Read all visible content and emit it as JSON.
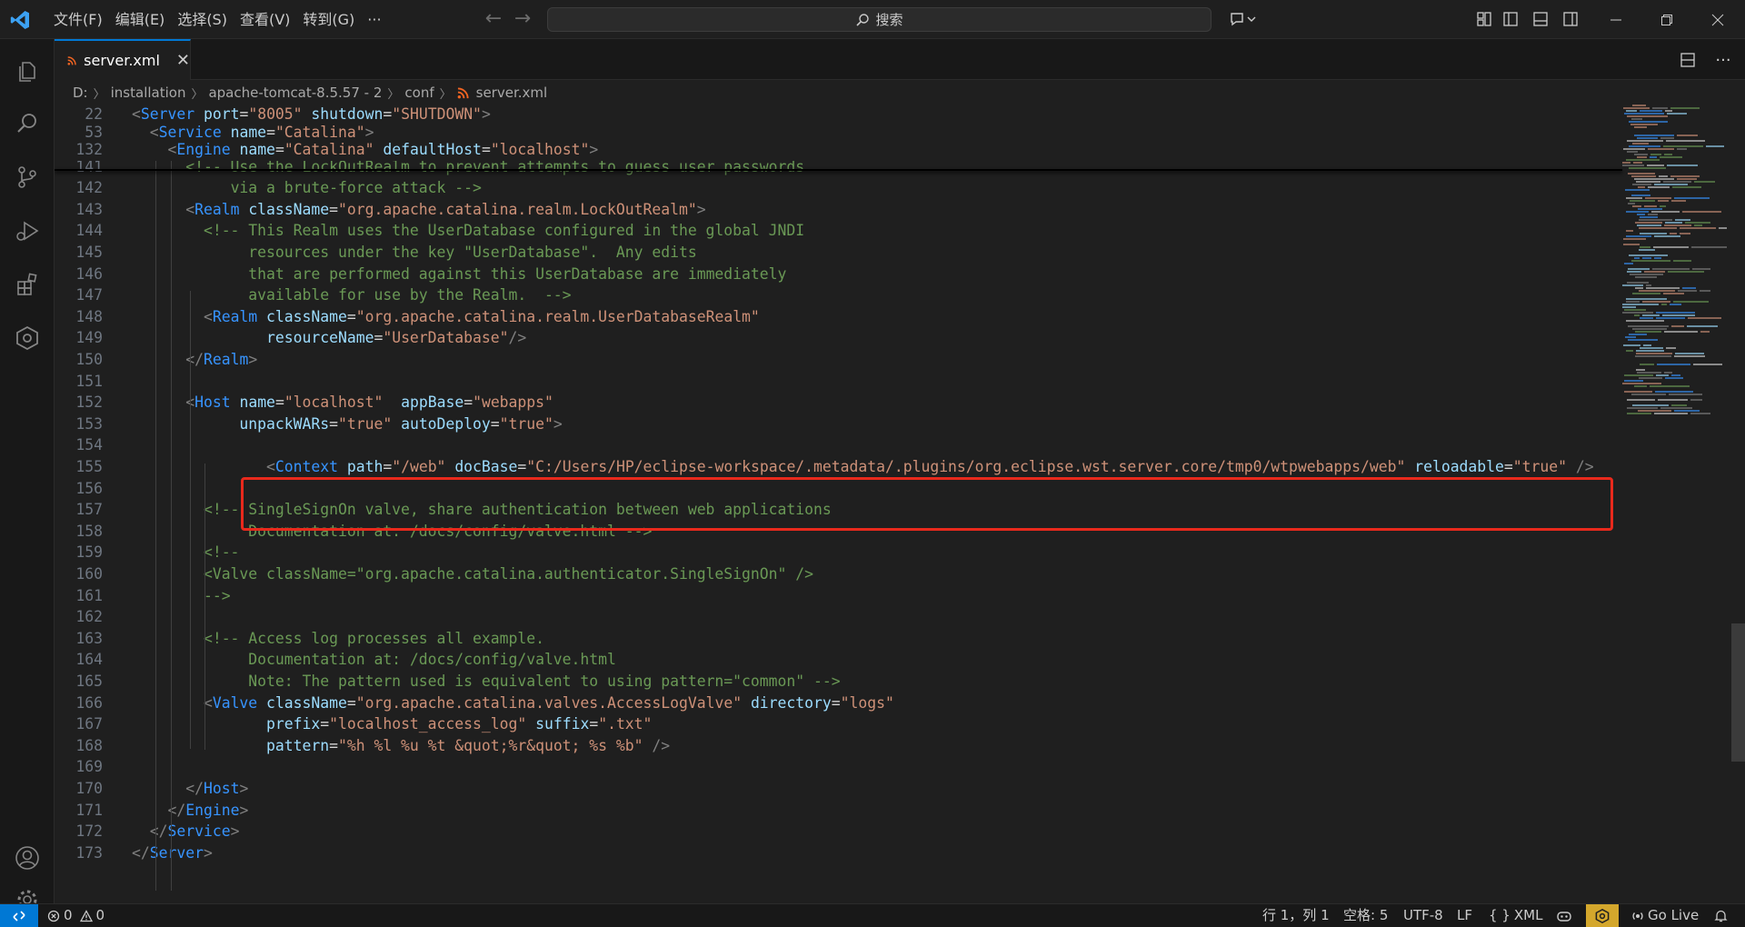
{
  "menu": [
    "文件(F)",
    "编辑(E)",
    "选择(S)",
    "查看(V)",
    "转到(G)",
    "···"
  ],
  "search": {
    "label": "搜索"
  },
  "colors": {
    "accent": "#0078d4",
    "highlight": "#e8291c",
    "copilot_status": "#d4a72c"
  },
  "tab": {
    "title": "server.xml",
    "icon": "rss-xml-file-icon"
  },
  "breadcrumb": [
    "D:",
    "installation",
    "apache-tomcat-8.5.57 - 2",
    "conf",
    "server.xml"
  ],
  "sticky": [
    {
      "ln": "22",
      "segs": [
        [
          "t-punc",
          "<"
        ],
        [
          "t-tag",
          "Server"
        ],
        [
          "t-text",
          " "
        ],
        [
          "t-attr",
          "port"
        ],
        [
          "t-text",
          "="
        ],
        [
          "t-str",
          "\"8005\""
        ],
        [
          "t-text",
          " "
        ],
        [
          "t-attr",
          "shutdown"
        ],
        [
          "t-text",
          "="
        ],
        [
          "t-str",
          "\"SHUTDOWN\""
        ],
        [
          "t-punc",
          ">"
        ]
      ],
      "indent": ""
    },
    {
      "ln": "53",
      "segs": [
        [
          "t-punc",
          "<"
        ],
        [
          "t-tag",
          "Service"
        ],
        [
          "t-text",
          " "
        ],
        [
          "t-attr",
          "name"
        ],
        [
          "t-text",
          "="
        ],
        [
          "t-str",
          "\"Catalina\""
        ],
        [
          "t-punc",
          ">"
        ]
      ],
      "indent": "  "
    },
    {
      "ln": "132",
      "segs": [
        [
          "t-punc",
          "<"
        ],
        [
          "t-tag",
          "Engine"
        ],
        [
          "t-text",
          " "
        ],
        [
          "t-attr",
          "name"
        ],
        [
          "t-text",
          "="
        ],
        [
          "t-str",
          "\"Catalina\""
        ],
        [
          "t-text",
          " "
        ],
        [
          "t-attr",
          "defaultHost"
        ],
        [
          "t-text",
          "="
        ],
        [
          "t-str",
          "\"localhost\""
        ],
        [
          "t-punc",
          ">"
        ]
      ],
      "indent": "    "
    }
  ],
  "lines": [
    {
      "ln": "140",
      "indent": "",
      "segs": []
    },
    {
      "ln": "141",
      "indent": "      ",
      "segs": [
        [
          "t-com",
          "<!-- Use the LockOutRealm to prevent attempts to guess user passwords"
        ]
      ]
    },
    {
      "ln": "142",
      "indent": "           ",
      "segs": [
        [
          "t-com",
          "via a brute-force attack -->"
        ]
      ]
    },
    {
      "ln": "143",
      "indent": "      ",
      "segs": [
        [
          "t-punc",
          "<"
        ],
        [
          "t-tag",
          "Realm"
        ],
        [
          "t-text",
          " "
        ],
        [
          "t-attr",
          "className"
        ],
        [
          "t-text",
          "="
        ],
        [
          "t-str",
          "\"org.apache.catalina.realm.LockOutRealm\""
        ],
        [
          "t-punc",
          ">"
        ]
      ]
    },
    {
      "ln": "144",
      "indent": "        ",
      "segs": [
        [
          "t-com",
          "<!-- This Realm uses the UserDatabase configured in the global JNDI"
        ]
      ]
    },
    {
      "ln": "145",
      "indent": "             ",
      "segs": [
        [
          "t-com",
          "resources under the key \"UserDatabase\".  Any edits"
        ]
      ]
    },
    {
      "ln": "146",
      "indent": "             ",
      "segs": [
        [
          "t-com",
          "that are performed against this UserDatabase are immediately"
        ]
      ]
    },
    {
      "ln": "147",
      "indent": "             ",
      "segs": [
        [
          "t-com",
          "available for use by the Realm.  -->"
        ]
      ]
    },
    {
      "ln": "148",
      "indent": "        ",
      "segs": [
        [
          "t-punc",
          "<"
        ],
        [
          "t-tag",
          "Realm"
        ],
        [
          "t-text",
          " "
        ],
        [
          "t-attr",
          "className"
        ],
        [
          "t-text",
          "="
        ],
        [
          "t-str",
          "\"org.apache.catalina.realm.UserDatabaseRealm\""
        ]
      ]
    },
    {
      "ln": "149",
      "indent": "               ",
      "segs": [
        [
          "t-attr",
          "resourceName"
        ],
        [
          "t-text",
          "="
        ],
        [
          "t-str",
          "\"UserDatabase\""
        ],
        [
          "t-punc",
          "/>"
        ]
      ]
    },
    {
      "ln": "150",
      "indent": "      ",
      "segs": [
        [
          "t-punc",
          "</"
        ],
        [
          "t-tag",
          "Realm"
        ],
        [
          "t-punc",
          ">"
        ]
      ]
    },
    {
      "ln": "151",
      "indent": "",
      "segs": []
    },
    {
      "ln": "152",
      "indent": "      ",
      "segs": [
        [
          "t-punc",
          "<"
        ],
        [
          "t-tag",
          "Host"
        ],
        [
          "t-text",
          " "
        ],
        [
          "t-attr",
          "name"
        ],
        [
          "t-text",
          "="
        ],
        [
          "t-str",
          "\"localhost\""
        ],
        [
          "t-text",
          "  "
        ],
        [
          "t-attr",
          "appBase"
        ],
        [
          "t-text",
          "="
        ],
        [
          "t-str",
          "\"webapps\""
        ]
      ]
    },
    {
      "ln": "153",
      "indent": "            ",
      "segs": [
        [
          "t-attr",
          "unpackWARs"
        ],
        [
          "t-text",
          "="
        ],
        [
          "t-str",
          "\"true\""
        ],
        [
          "t-text",
          " "
        ],
        [
          "t-attr",
          "autoDeploy"
        ],
        [
          "t-text",
          "="
        ],
        [
          "t-str",
          "\"true\""
        ],
        [
          "t-punc",
          ">"
        ]
      ]
    },
    {
      "ln": "154",
      "indent": "",
      "segs": []
    },
    {
      "ln": "155",
      "indent": "               ",
      "segs": [
        [
          "t-punc",
          "<"
        ],
        [
          "t-tag",
          "Context"
        ],
        [
          "t-text",
          " "
        ],
        [
          "t-attr",
          "path"
        ],
        [
          "t-text",
          "="
        ],
        [
          "t-str",
          "\"/web\""
        ],
        [
          "t-text",
          " "
        ],
        [
          "t-attr",
          "docBase"
        ],
        [
          "t-text",
          "="
        ],
        [
          "t-str",
          "\"C:/Users/HP/eclipse-workspace/.metadata/.plugins/org.eclipse.wst.server.core/tmp0/wtpwebapps/web\""
        ],
        [
          "t-text",
          " "
        ],
        [
          "t-attr",
          "reloadable"
        ],
        [
          "t-text",
          "="
        ],
        [
          "t-str",
          "\"true\""
        ],
        [
          "t-text",
          " "
        ],
        [
          "t-punc",
          "/>"
        ]
      ]
    },
    {
      "ln": "156",
      "indent": "",
      "segs": []
    },
    {
      "ln": "157",
      "indent": "        ",
      "segs": [
        [
          "t-com",
          "<!-- SingleSignOn valve, share authentication between web applications"
        ]
      ]
    },
    {
      "ln": "158",
      "indent": "             ",
      "segs": [
        [
          "t-com",
          "Documentation at: /docs/config/valve.html -->"
        ]
      ]
    },
    {
      "ln": "159",
      "indent": "        ",
      "segs": [
        [
          "t-com",
          "<!--"
        ]
      ]
    },
    {
      "ln": "160",
      "indent": "        ",
      "segs": [
        [
          "t-com",
          "<Valve className=\"org.apache.catalina.authenticator.SingleSignOn\" />"
        ]
      ]
    },
    {
      "ln": "161",
      "indent": "        ",
      "segs": [
        [
          "t-com",
          "-->"
        ]
      ]
    },
    {
      "ln": "162",
      "indent": "",
      "segs": []
    },
    {
      "ln": "163",
      "indent": "        ",
      "segs": [
        [
          "t-com",
          "<!-- Access log processes all example."
        ]
      ]
    },
    {
      "ln": "164",
      "indent": "             ",
      "segs": [
        [
          "t-com",
          "Documentation at: /docs/config/valve.html"
        ]
      ]
    },
    {
      "ln": "165",
      "indent": "             ",
      "segs": [
        [
          "t-com",
          "Note: The pattern used is equivalent to using pattern=\"common\" -->"
        ]
      ]
    },
    {
      "ln": "166",
      "indent": "        ",
      "segs": [
        [
          "t-punc",
          "<"
        ],
        [
          "t-tag",
          "Valve"
        ],
        [
          "t-text",
          " "
        ],
        [
          "t-attr",
          "className"
        ],
        [
          "t-text",
          "="
        ],
        [
          "t-str",
          "\"org.apache.catalina.valves.AccessLogValve\""
        ],
        [
          "t-text",
          " "
        ],
        [
          "t-attr",
          "directory"
        ],
        [
          "t-text",
          "="
        ],
        [
          "t-str",
          "\"logs\""
        ]
      ]
    },
    {
      "ln": "167",
      "indent": "               ",
      "segs": [
        [
          "t-attr",
          "prefix"
        ],
        [
          "t-text",
          "="
        ],
        [
          "t-str",
          "\"localhost_access_log\""
        ],
        [
          "t-text",
          " "
        ],
        [
          "t-attr",
          "suffix"
        ],
        [
          "t-text",
          "="
        ],
        [
          "t-str",
          "\".txt\""
        ]
      ]
    },
    {
      "ln": "168",
      "indent": "               ",
      "segs": [
        [
          "t-attr",
          "pattern"
        ],
        [
          "t-text",
          "="
        ],
        [
          "t-str",
          "\"%h %l %u %t &quot;%r&quot; %s %b\""
        ],
        [
          "t-text",
          " "
        ],
        [
          "t-punc",
          "/>"
        ]
      ]
    },
    {
      "ln": "169",
      "indent": "",
      "segs": []
    },
    {
      "ln": "170",
      "indent": "      ",
      "segs": [
        [
          "t-punc",
          "</"
        ],
        [
          "t-tag",
          "Host"
        ],
        [
          "t-punc",
          ">"
        ]
      ]
    },
    {
      "ln": "171",
      "indent": "    ",
      "segs": [
        [
          "t-punc",
          "</"
        ],
        [
          "t-tag",
          "Engine"
        ],
        [
          "t-punc",
          ">"
        ]
      ]
    },
    {
      "ln": "172",
      "indent": "  ",
      "segs": [
        [
          "t-punc",
          "</"
        ],
        [
          "t-tag",
          "Service"
        ],
        [
          "t-punc",
          ">"
        ]
      ]
    },
    {
      "ln": "173",
      "indent": "",
      "segs": [
        [
          "t-punc",
          "</"
        ],
        [
          "t-tag",
          "Server"
        ],
        [
          "t-punc",
          ">"
        ]
      ]
    }
  ],
  "status": {
    "errors": "0",
    "warnings": "0",
    "position": "行 1，列 1",
    "indent": "空格: 5",
    "encoding": "UTF-8",
    "eol": "LF",
    "language": "XML",
    "golive": "Go Live"
  }
}
